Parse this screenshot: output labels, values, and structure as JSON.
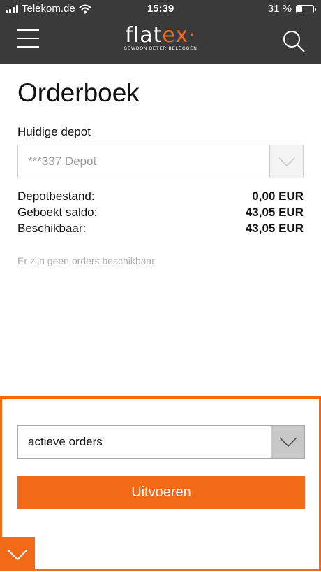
{
  "status_bar": {
    "carrier": "Telekom.de",
    "time": "15:39",
    "battery": "31 %",
    "battery_level": 0.31
  },
  "nav": {
    "logo_text_main": "flat",
    "logo_text_accent": "ex",
    "logo_tagline": "GEWOON BETER BELEGGEN",
    "menu_icon": "hamburger-icon",
    "search_icon": "search-icon"
  },
  "page": {
    "title": "Orderboek",
    "depot_label": "Huidige depot",
    "depot_value": "***337 Depot",
    "rows": [
      {
        "label": "Depotbestand:",
        "amount": "0,00 EUR"
      },
      {
        "label": "Geboekt saldo:",
        "amount": "43,05 EUR"
      },
      {
        "label": "Beschikbaar:",
        "amount": "43,05 EUR"
      }
    ],
    "empty_message": "Er zijn geen orders beschikbaar."
  },
  "panel": {
    "order_filter": "actieve orders",
    "submit_label": "Uitvoeren"
  },
  "colors": {
    "accent": "#f26a18",
    "header": "#3a3a3a"
  }
}
